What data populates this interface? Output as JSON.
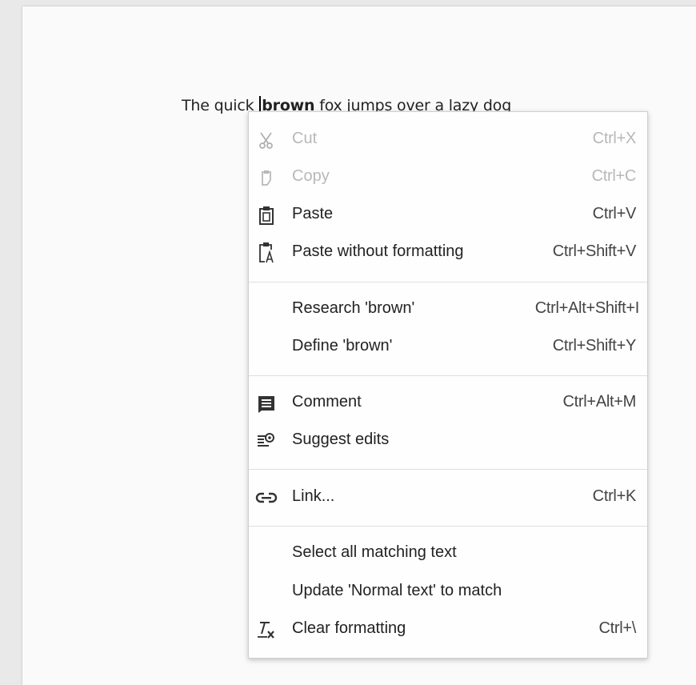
{
  "document": {
    "text_before": "The quick ",
    "text_selected": "brown",
    "text_after": " fox jumps over a lazy dog"
  },
  "context_menu": {
    "cut": {
      "label": "Cut",
      "shortcut": "Ctrl+X",
      "icon": "scissors-icon",
      "enabled": false
    },
    "copy": {
      "label": "Copy",
      "shortcut": "Ctrl+C",
      "icon": "copy-icon",
      "enabled": false
    },
    "paste": {
      "label": "Paste",
      "shortcut": "Ctrl+V",
      "icon": "clipboard-icon"
    },
    "paste_plain": {
      "label": "Paste without formatting",
      "shortcut": "Ctrl+Shift+V",
      "icon": "clipboard-text-icon"
    },
    "research": {
      "label": "Research 'brown'",
      "shortcut": "Ctrl+Alt+Shift+I"
    },
    "define": {
      "label": "Define 'brown'",
      "shortcut": "Ctrl+Shift+Y"
    },
    "comment": {
      "label": "Comment",
      "shortcut": "Ctrl+Alt+M",
      "icon": "comment-icon"
    },
    "suggest": {
      "label": "Suggest edits",
      "icon": "suggest-edits-icon"
    },
    "link": {
      "label": "Link...",
      "shortcut": "Ctrl+K",
      "icon": "link-icon"
    },
    "select_matching": {
      "label": "Select all matching text"
    },
    "update_normal": {
      "label": "Update 'Normal text' to match"
    },
    "clear_formatting": {
      "label": "Clear formatting",
      "shortcut": "Ctrl+\\",
      "icon": "clear-formatting-icon"
    }
  }
}
